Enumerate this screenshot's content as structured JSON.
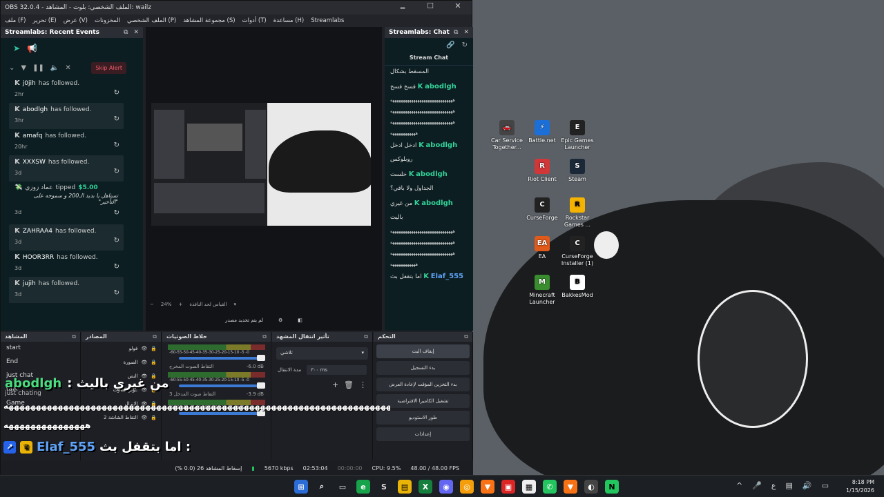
{
  "window": {
    "title": "OBS 32.0.4 - الملف الشخصي: بلوت - المشاهد: wailz",
    "min": "🗕",
    "max": "☐",
    "close": "✕"
  },
  "menu": [
    "ملف (F)",
    "تحرير (E)",
    "عرض (V)",
    "المخزونات",
    "الملف الشخصي (P)",
    "مجموعة المشاهد (S)",
    "أدوات (T)",
    "مساعدة (H)",
    "Streamlabs"
  ],
  "events": {
    "title": "Streamlabs: Recent Events",
    "skip_label": "Skip Alert",
    "items": [
      {
        "name": "j0jih",
        "action": "has followed.",
        "time": "2hr"
      },
      {
        "name": "abodlgh",
        "action": "has followed.",
        "time": "3hr"
      },
      {
        "name": "amafq",
        "action": "has followed.",
        "time": "20hr"
      },
      {
        "name": "XXXSW",
        "action": "has followed.",
        "time": "3d"
      },
      {
        "name": "عماد زوزي",
        "action": "tipped",
        "amount": "$5.00",
        "message": "تستاهل يا بديد الـ200 و سموحه على \"التأخير\"",
        "time": "3d"
      },
      {
        "name": "ZAHRAA4",
        "action": "has followed.",
        "time": "3d"
      },
      {
        "name": "HOOR3RR",
        "action": "has followed.",
        "time": "3d"
      },
      {
        "name": "jujih",
        "action": "has followed.",
        "time": "3d"
      }
    ]
  },
  "preview": {
    "zoom": "24%",
    "zoom_minus": "−",
    "zoom_plus": "+",
    "fit_label": "القياس لحد النافذة",
    "no_source": "لم يتم تحديد مصدر"
  },
  "chat": {
    "title": "Streamlabs: Chat",
    "subtitle": "Stream Chat",
    "messages": [
      {
        "user": "",
        "text": "المسقط بشكال"
      },
      {
        "user": "abodlgh",
        "text": "فسخ فسخ"
      },
      {
        "user": "",
        "text": "ههههههههههههههههههههههههههههههه"
      },
      {
        "user": "",
        "text": "ههههههههههههههههههههههههههههههه"
      },
      {
        "user": "",
        "text": "ههههههههههههههههههههههههههههههه"
      },
      {
        "user": "",
        "text": "ههههههههههههه"
      },
      {
        "user": "abodlgh",
        "text": "ادخل ادخل"
      },
      {
        "user": "",
        "text": "روبلوكس"
      },
      {
        "user": "abodlgh",
        "text": "خلست"
      },
      {
        "user": "",
        "text": "الجداول ولا باقي؟"
      },
      {
        "user": "abodlgh",
        "text": "من غيري"
      },
      {
        "user": "",
        "text": "باليت"
      },
      {
        "user": "",
        "text": "ههههههههههههههههههههههههههههههه"
      },
      {
        "user": "",
        "text": "ههههههههههههههههههههههههههههههه"
      },
      {
        "user": "",
        "text": "ههههههههههههههههههههههههههههههه"
      },
      {
        "user": "",
        "text": "ههههههههههههه"
      },
      {
        "user": "Elaf_555",
        "text": "اما بتقفل بث"
      }
    ]
  },
  "docks": {
    "scenes": {
      "title": "المشاهد",
      "items": [
        "start",
        "End",
        "just chat",
        "talk",
        "Game"
      ]
    },
    "sources": {
      "title": "المصادر",
      "items": [
        "فولو",
        "الصورة",
        "النص",
        "مؤثر الصوت",
        "الإنزال",
        "التقاط الشاشة 2"
      ]
    },
    "mixer": {
      "title": "خلاط الصوتيات",
      "channels": [
        {
          "label": "",
          "value": ""
        },
        {
          "label": "التقاط الصوت المخرج",
          "value": "-6.0 dB"
        },
        {
          "label": "التقاط صوت المدخل 3",
          "value": "-3.9 dB"
        }
      ],
      "ticks": "-60-55-50-45-40-35-30-25-20-15-10 -5 -0"
    },
    "transitions": {
      "title": "تأثير انتقال المشهد",
      "selected": "تلاشي",
      "duration_label": "مدة الانتقال",
      "duration": "٣٠٠ ms"
    },
    "controls": {
      "title": "التحكم",
      "buttons": [
        "إيقاف البث",
        "بدء التسجيل",
        "بدء التخزين المؤقت لإعادة العرض",
        "تشغيل الكاميرا الافتراضية",
        "طور الاستوديو",
        "إعدادات"
      ]
    }
  },
  "overlay": {
    "line1_name": "abodlgh",
    "line1_text": "من غيري باليث :",
    "category": "just chating",
    "spam": "ههههههههههههههههههههههههههههههههههههههههههههههههههههههههههههههههههههههههه",
    "spam2": "هههههههههههههههه",
    "line2_name": "Elaf_555",
    "line2_text": "اما بتقفل بث :"
  },
  "status": {
    "dropped": "إسقاط المشاهد 26 (0.0 %)",
    "bitrate": "5670 kbps",
    "stream_time": "02:53:04",
    "rec_time": "00:00:00",
    "cpu": "CPU: 9.5%",
    "fps": "48.00 / 48.00 FPS"
  },
  "desktop_icons": [
    {
      "label": "Car Service Together...",
      "color": "#444"
    },
    {
      "label": "Battle.net",
      "color": "#1c6fd6"
    },
    {
      "label": "Epic Games Launcher",
      "color": "#222"
    },
    {
      "label": "Riot Client",
      "color": "#d13639"
    },
    {
      "label": "Steam",
      "color": "#1b2838"
    },
    {
      "label": "CurseForge",
      "color": "#222"
    },
    {
      "label": "Rockstar Games ...",
      "color": "#f3b300"
    },
    {
      "label": "EA",
      "color": "#e05a1b"
    },
    {
      "label": "CurseForge Installer (1)",
      "color": "#222"
    },
    {
      "label": "Minecraft Launcher",
      "color": "#3a8d2f"
    },
    {
      "label": "BakkesMod",
      "color": "#fff"
    }
  ],
  "clock": {
    "time": "8:18 PM",
    "date": "1/15/2026"
  }
}
